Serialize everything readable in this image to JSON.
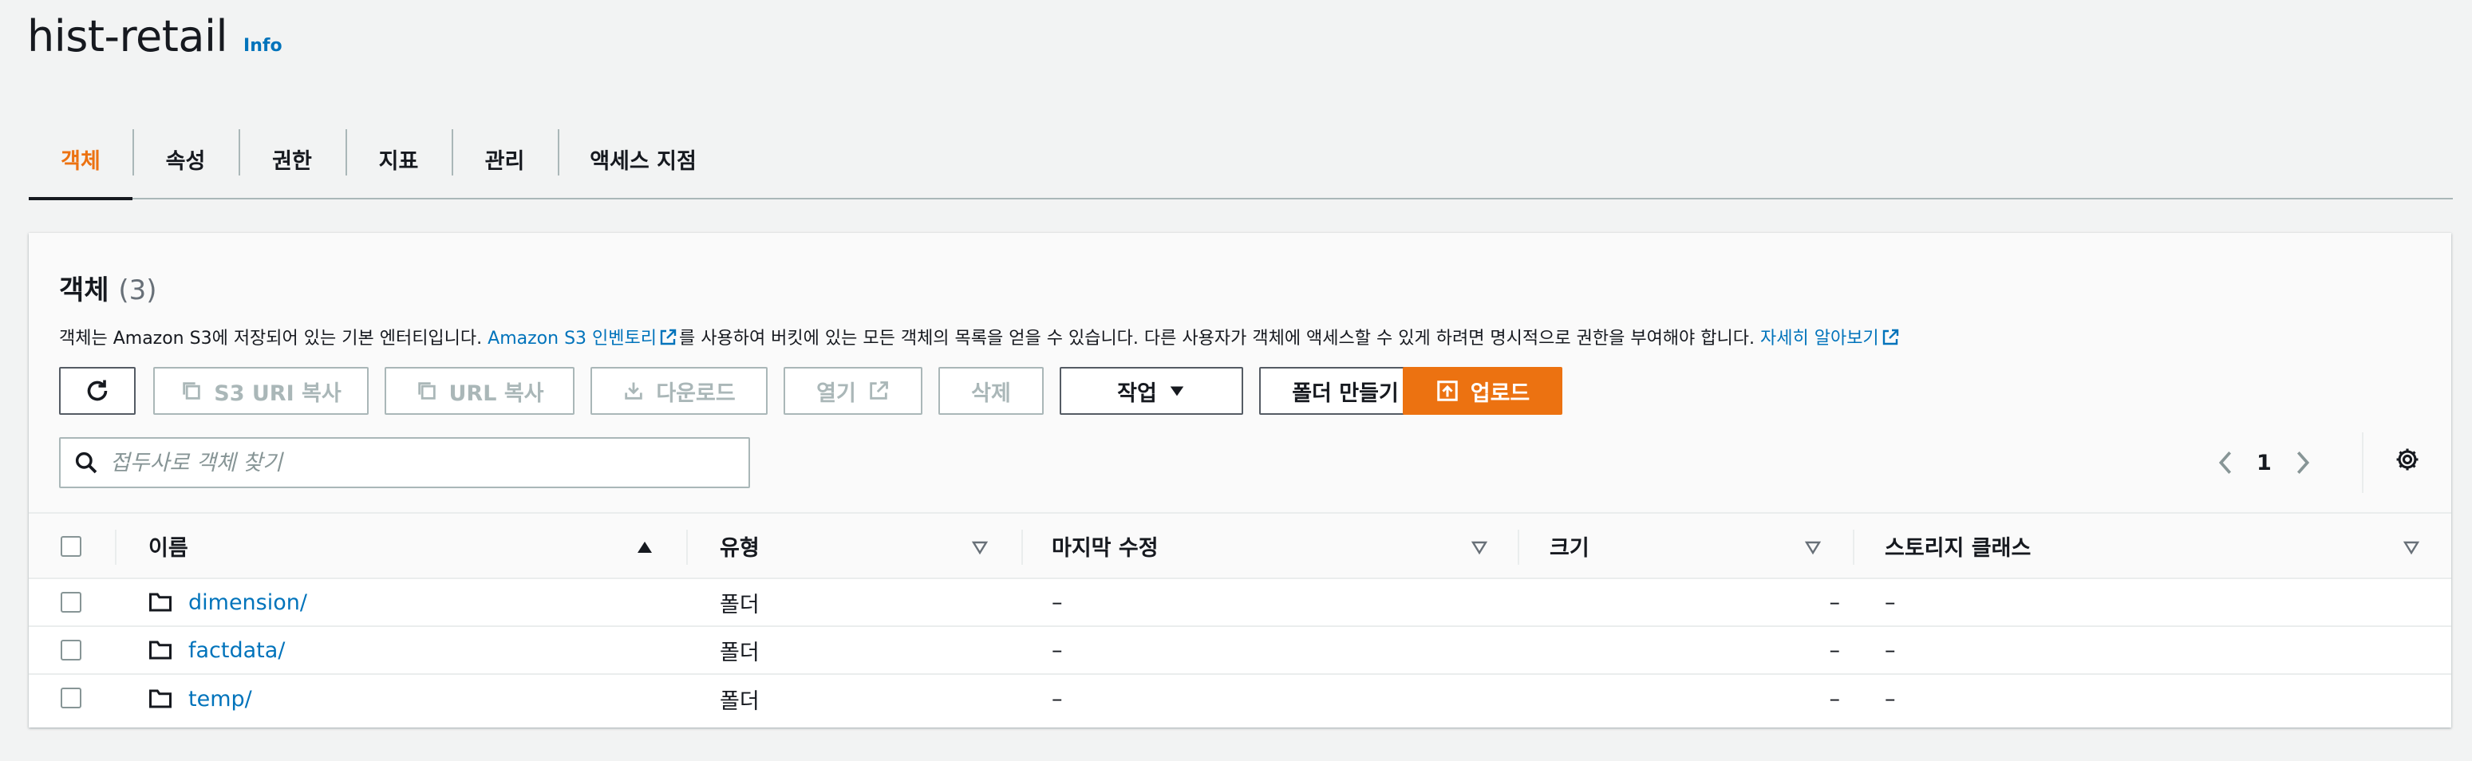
{
  "header": {
    "title": "hist-retail",
    "info_label": "Info"
  },
  "tabs": [
    {
      "label": "객체",
      "active": true
    },
    {
      "label": "속성"
    },
    {
      "label": "권한"
    },
    {
      "label": "지표"
    },
    {
      "label": "관리"
    },
    {
      "label": "액세스 지점"
    }
  ],
  "panel": {
    "title": "객체",
    "count": "(3)",
    "desc_part1": "객체는 Amazon S3에 저장되어 있는 기본 엔터티입니다. ",
    "desc_link1": "Amazon S3 인벤토리",
    "desc_part2": "를 사용하여 버킷에 있는 모든 객체의 목록을 얻을 수 있습니다. 다른 사용자가 객체에 액세스할 수 있게 하려면 명시적으로 권한을 부여해야 합니다. ",
    "desc_link2": "자세히 알아보기"
  },
  "toolbar": {
    "copy_s3_uri": "S3 URI 복사",
    "copy_url": "URL 복사",
    "download": "다운로드",
    "open": "열기",
    "delete": "삭제",
    "actions": "작업",
    "create_folder": "폴더 만들기",
    "upload": "업로드"
  },
  "search": {
    "placeholder": "접두사로 객체 찾기",
    "value": ""
  },
  "pagination": {
    "current_page": "1"
  },
  "table": {
    "columns": {
      "name": "이름",
      "type": "유형",
      "last_modified": "마지막 수정",
      "size": "크기",
      "storage_class": "스토리지 클래스"
    },
    "rows": [
      {
        "name": "dimension/",
        "type": "폴더",
        "last_modified": "–",
        "size": "–",
        "storage_class": "–"
      },
      {
        "name": "factdata/",
        "type": "폴더",
        "last_modified": "–",
        "size": "–",
        "storage_class": "–"
      },
      {
        "name": "temp/",
        "type": "폴더",
        "last_modified": "–",
        "size": "–",
        "storage_class": "–"
      }
    ]
  },
  "colors": {
    "accent": "#ec7211",
    "link": "#0073bb",
    "text": "#16191f",
    "disabled": "#aab7b8",
    "background": "#f2f3f3"
  }
}
